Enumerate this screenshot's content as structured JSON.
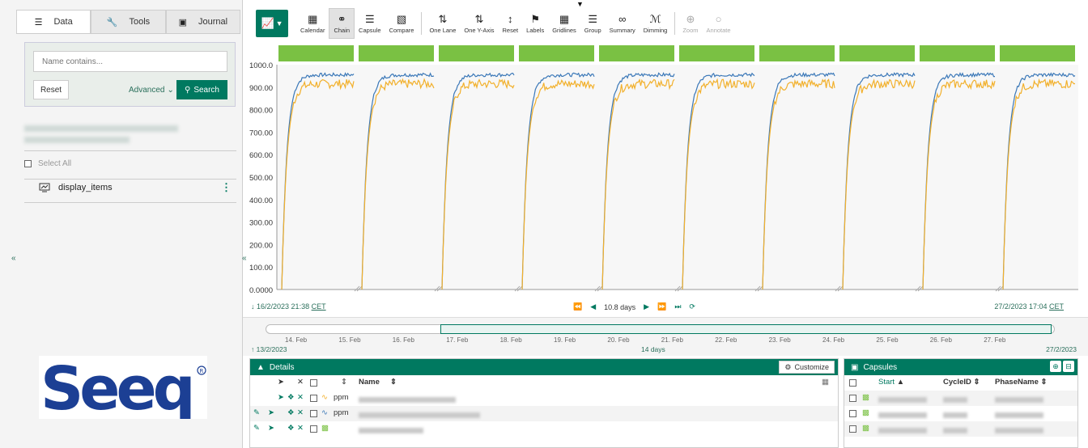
{
  "left_panel": {
    "tabs": [
      {
        "label": "Data",
        "icon": "database-icon"
      },
      {
        "label": "Tools",
        "icon": "wrench-icon"
      },
      {
        "label": "Journal",
        "icon": "book-icon"
      }
    ],
    "search": {
      "placeholder": "Name contains...",
      "reset_label": "Reset",
      "advanced_label": "Advanced",
      "search_label": "Search"
    },
    "select_all_label": "Select All",
    "item_label": "display_items",
    "logo_text": "Seeq"
  },
  "toolbar": {
    "buttons": [
      {
        "label": "Calendar",
        "icon": "calendar-icon"
      },
      {
        "label": "Chain",
        "icon": "chain-icon"
      },
      {
        "label": "Capsule",
        "icon": "capsule-icon"
      },
      {
        "label": "Compare",
        "icon": "compare-icon"
      },
      {
        "label": "One Lane",
        "icon": "one-lane-icon"
      },
      {
        "label": "One Y-Axis",
        "icon": "one-y-axis-icon"
      },
      {
        "label": "Reset",
        "icon": "reset-axis-icon"
      },
      {
        "label": "Labels",
        "icon": "labels-icon"
      },
      {
        "label": "Gridlines",
        "icon": "gridlines-icon"
      },
      {
        "label": "Group",
        "icon": "group-icon"
      },
      {
        "label": "Summary",
        "icon": "summary-icon"
      },
      {
        "label": "Dimming",
        "icon": "dimming-icon"
      },
      {
        "label": "Zoom",
        "icon": "zoom-icon"
      },
      {
        "label": "Annotate",
        "icon": "annotate-icon"
      }
    ]
  },
  "trend": {
    "y_ticks": [
      "1000.0",
      "900.00",
      "800.00",
      "700.00",
      "600.00",
      "500.00",
      "400.00",
      "300.00",
      "200.00",
      "100.00",
      "0.0000"
    ],
    "start_date": "16/2/2023 21:38",
    "end_date": "27/2/2023 17:04",
    "timezone": "CET",
    "span_label": "10.8 days",
    "colors": {
      "series_blue": "#3b78b8",
      "series_orange": "#f2b02b",
      "capsule_green": "#7ac143",
      "accent": "#007960"
    }
  },
  "chart_data": {
    "type": "line",
    "x_unit": "capsule",
    "capsules": 10,
    "y_range": [
      0,
      1000
    ],
    "series": [
      {
        "color": "#3b78b8",
        "plateau": 955
      },
      {
        "color": "#f2b02b",
        "plateau": 915
      }
    ]
  },
  "timeline": {
    "labels": [
      "14. Feb",
      "15. Feb",
      "16. Feb",
      "17. Feb",
      "18. Feb",
      "19. Feb",
      "20. Feb",
      "21. Feb",
      "22. Feb",
      "23. Feb",
      "24. Feb",
      "25. Feb",
      "26. Feb",
      "27. Feb"
    ],
    "start": "13/2/2023",
    "span": "14 days",
    "end": "27/2/2023"
  },
  "details": {
    "title": "Details",
    "customize_label": "Customize",
    "name_header": "Name",
    "rows": [
      {
        "unit": "ppm",
        "name_width": 120
      },
      {
        "unit": "ppm",
        "name_width": 150
      },
      {
        "unit": "",
        "name_width": 80
      }
    ]
  },
  "capsules_panel": {
    "title": "Capsules",
    "headers": [
      "Start",
      "CycleID",
      "PhaseName"
    ]
  }
}
